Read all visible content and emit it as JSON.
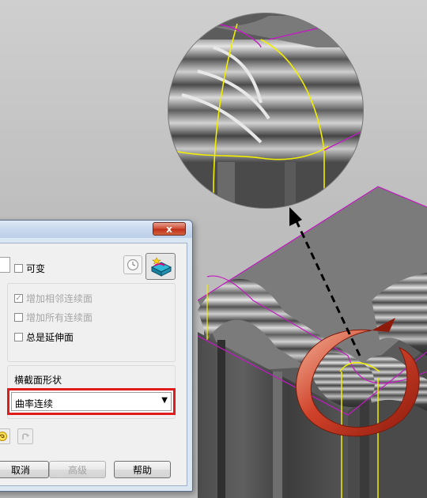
{
  "dialog": {
    "close_label": "x",
    "checkboxes": {
      "variable": {
        "label": "可变",
        "checked": false
      },
      "add_adjacent": {
        "label": "增加相邻连续面",
        "checked": true,
        "mark": "✓"
      },
      "add_all": {
        "label": "增加所有连续面",
        "checked": false
      },
      "always_extend": {
        "label": "总是延伸面",
        "checked": false
      }
    },
    "cross_section": {
      "label": "横截面形状",
      "selected": "曲率连续",
      "arrow": "▼"
    },
    "buttons": {
      "cancel": "取消",
      "advanced": "高级",
      "help": "帮助"
    }
  },
  "colors": {
    "highlight_border": "#e01b1b",
    "edge_yellow": "#f2ee00",
    "edge_magenta": "#c21ac2"
  }
}
